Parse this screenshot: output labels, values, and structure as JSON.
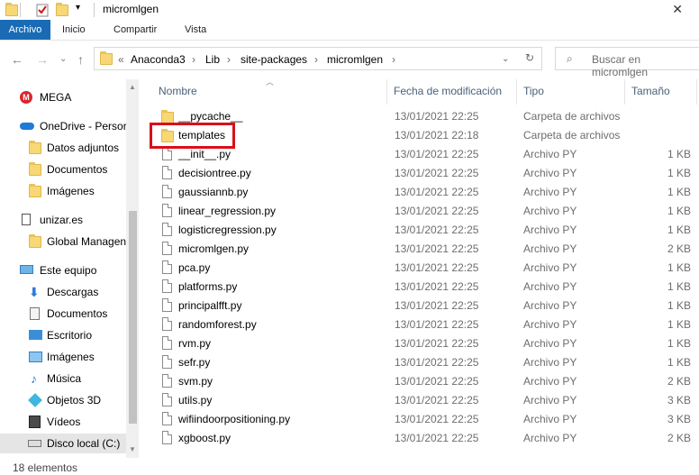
{
  "window": {
    "title": "micromlgen"
  },
  "ribbon": {
    "tabs": [
      "Archivo",
      "Inicio",
      "Compartir",
      "Vista"
    ]
  },
  "address": {
    "overflow": "«",
    "crumbs": [
      "Anaconda3",
      "Lib",
      "site-packages",
      "micromlgen"
    ],
    "search_placeholder": "Buscar en micromlgen"
  },
  "nav": {
    "items": [
      {
        "label": "MEGA",
        "icon": "mega-icon"
      },
      {
        "label": "OneDrive - Persor",
        "icon": "onedrive-icon"
      },
      {
        "label": "Datos adjuntos",
        "icon": "folder-icon"
      },
      {
        "label": "Documentos",
        "icon": "folder-icon"
      },
      {
        "label": "Imágenes",
        "icon": "folder-icon"
      },
      {
        "label": "unizar.es",
        "icon": "building-icon"
      },
      {
        "label": "Global Managen",
        "icon": "folder-icon"
      },
      {
        "label": "Este equipo",
        "icon": "computer-icon"
      },
      {
        "label": "Descargas",
        "icon": "download-icon"
      },
      {
        "label": "Documentos",
        "icon": "document-icon"
      },
      {
        "label": "Escritorio",
        "icon": "desktop-icon"
      },
      {
        "label": "Imágenes",
        "icon": "pictures-icon"
      },
      {
        "label": "Música",
        "icon": "music-icon"
      },
      {
        "label": "Objetos 3D",
        "icon": "cube-icon"
      },
      {
        "label": "Vídeos",
        "icon": "video-icon"
      },
      {
        "label": "Disco local (C:)",
        "icon": "drive-icon"
      }
    ]
  },
  "columns": {
    "name": "Nombre",
    "date": "Fecha de modificación",
    "type": "Tipo",
    "size": "Tamaño"
  },
  "files": [
    {
      "name": "__pycache__",
      "date": "13/01/2021 22:25",
      "type": "Carpeta de archivos",
      "size": "",
      "kind": "folder"
    },
    {
      "name": "templates",
      "date": "13/01/2021 22:18",
      "type": "Carpeta de archivos",
      "size": "",
      "kind": "folder"
    },
    {
      "name": "__init__.py",
      "date": "13/01/2021 22:25",
      "type": "Archivo PY",
      "size": "1 KB",
      "kind": "file"
    },
    {
      "name": "decisiontree.py",
      "date": "13/01/2021 22:25",
      "type": "Archivo PY",
      "size": "1 KB",
      "kind": "file"
    },
    {
      "name": "gaussiannb.py",
      "date": "13/01/2021 22:25",
      "type": "Archivo PY",
      "size": "1 KB",
      "kind": "file"
    },
    {
      "name": "linear_regression.py",
      "date": "13/01/2021 22:25",
      "type": "Archivo PY",
      "size": "1 KB",
      "kind": "file"
    },
    {
      "name": "logisticregression.py",
      "date": "13/01/2021 22:25",
      "type": "Archivo PY",
      "size": "1 KB",
      "kind": "file"
    },
    {
      "name": "micromlgen.py",
      "date": "13/01/2021 22:25",
      "type": "Archivo PY",
      "size": "2 KB",
      "kind": "file"
    },
    {
      "name": "pca.py",
      "date": "13/01/2021 22:25",
      "type": "Archivo PY",
      "size": "1 KB",
      "kind": "file"
    },
    {
      "name": "platforms.py",
      "date": "13/01/2021 22:25",
      "type": "Archivo PY",
      "size": "1 KB",
      "kind": "file"
    },
    {
      "name": "principalfft.py",
      "date": "13/01/2021 22:25",
      "type": "Archivo PY",
      "size": "1 KB",
      "kind": "file"
    },
    {
      "name": "randomforest.py",
      "date": "13/01/2021 22:25",
      "type": "Archivo PY",
      "size": "1 KB",
      "kind": "file"
    },
    {
      "name": "rvm.py",
      "date": "13/01/2021 22:25",
      "type": "Archivo PY",
      "size": "1 KB",
      "kind": "file"
    },
    {
      "name": "sefr.py",
      "date": "13/01/2021 22:25",
      "type": "Archivo PY",
      "size": "1 KB",
      "kind": "file"
    },
    {
      "name": "svm.py",
      "date": "13/01/2021 22:25",
      "type": "Archivo PY",
      "size": "2 KB",
      "kind": "file"
    },
    {
      "name": "utils.py",
      "date": "13/01/2021 22:25",
      "type": "Archivo PY",
      "size": "3 KB",
      "kind": "file"
    },
    {
      "name": "wifiindoorpositioning.py",
      "date": "13/01/2021 22:25",
      "type": "Archivo PY",
      "size": "3 KB",
      "kind": "file"
    },
    {
      "name": "xgboost.py",
      "date": "13/01/2021 22:25",
      "type": "Archivo PY",
      "size": "2 KB",
      "kind": "file"
    }
  ],
  "status": {
    "count": "18 elementos"
  },
  "colors": {
    "accent": "#1a6bb5",
    "highlight": "#d8101a",
    "folder": "#f8d775"
  }
}
